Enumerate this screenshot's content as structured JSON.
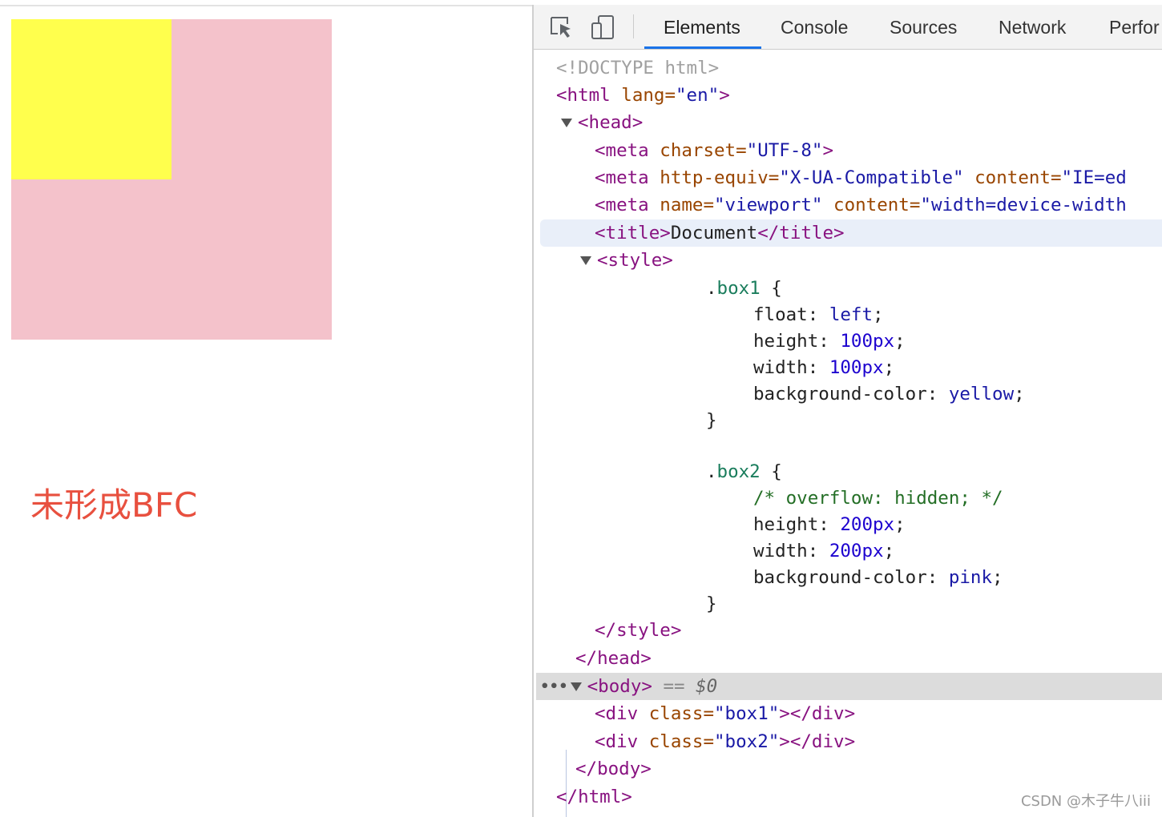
{
  "render": {
    "caption": "未形成BFC",
    "colors": {
      "box1": "#ffff4d",
      "box2": "#f4c2cb",
      "caption": "#e8503f"
    }
  },
  "devtools": {
    "tabs": [
      "Elements",
      "Console",
      "Sources",
      "Network",
      "Perfor"
    ],
    "active_tab": "Elements",
    "tools": [
      "inspect-element-icon",
      "device-toolbar-icon"
    ],
    "dom": {
      "doctype": "<!DOCTYPE html>",
      "html_open": {
        "tag": "<html",
        "attr": "lang=",
        "val": "\"en\"",
        "close": ">"
      },
      "head_open": "<head>",
      "meta1": {
        "tag": "<meta",
        "attr": "charset=",
        "val": "\"UTF-8\"",
        "close": ">"
      },
      "meta2": {
        "tag": "<meta",
        "attr1": "http-equiv=",
        "val1": "\"X-UA-Compatible\"",
        "attr2": "content=",
        "val2": "\"IE=ed"
      },
      "meta3": {
        "tag": "<meta",
        "attr1": "name=",
        "val1": "\"viewport\"",
        "attr2": "content=",
        "val2": "\"width=device-width"
      },
      "title": {
        "open": "<title>",
        "text": "Document",
        "close": "</title>"
      },
      "style_open": "<style>",
      "css": {
        "box1_selector": ".box1",
        "box1_props": [
          {
            "prop": "float",
            "value": "left"
          },
          {
            "prop": "height",
            "value": "100px"
          },
          {
            "prop": "width",
            "value": "100px"
          },
          {
            "prop": "background-color",
            "value": "yellow"
          }
        ],
        "box2_selector": ".box2",
        "box2_comment": "/* overflow: hidden; */",
        "box2_props": [
          {
            "prop": "height",
            "value": "200px"
          },
          {
            "prop": "width",
            "value": "200px"
          },
          {
            "prop": "background-color",
            "value": "pink"
          }
        ],
        "open_brace": "{",
        "close_brace": "}"
      },
      "style_close": "</style>",
      "head_close": "</head>",
      "body_open": "<body>",
      "body_eq": "==",
      "body_ref": "$0",
      "div1": {
        "tag": "<div",
        "attr": "class=",
        "val": "\"box1\"",
        "close": "></div>"
      },
      "div2": {
        "tag": "<div",
        "attr": "class=",
        "val": "\"box2\"",
        "close": "></div>"
      },
      "body_close": "</body>",
      "html_close": "</html>"
    }
  },
  "watermark": "CSDN @木子牛八iii"
}
